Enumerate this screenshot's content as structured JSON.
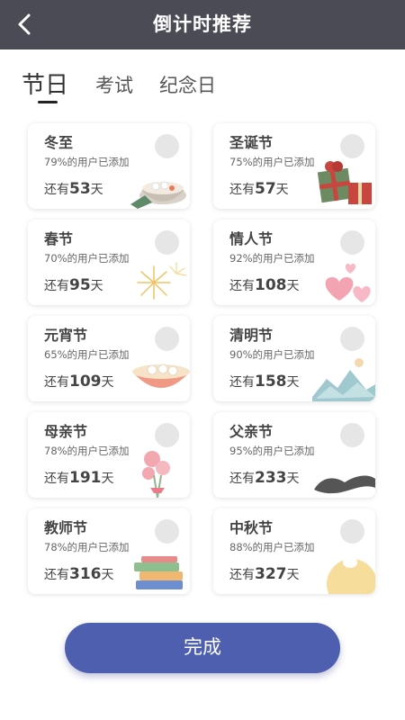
{
  "header": {
    "title": "倒计时推荐",
    "back_icon": "back-arrow-icon"
  },
  "tabs": [
    {
      "label": "节日",
      "active": true
    },
    {
      "label": "考试",
      "active": false
    },
    {
      "label": "纪念日",
      "active": false
    }
  ],
  "days_prefix": "还有",
  "days_suffix": "天",
  "cards": [
    {
      "name": "冬至",
      "pct": "79%的用户已添加",
      "days": "53",
      "illustration": "dumpling-bowl-icon"
    },
    {
      "name": "圣诞节",
      "pct": "75%的用户已添加",
      "days": "57",
      "illustration": "gift-boxes-icon"
    },
    {
      "name": "春节",
      "pct": "70%的用户已添加",
      "days": "95",
      "illustration": "fireworks-icon"
    },
    {
      "name": "情人节",
      "pct": "92%的用户已添加",
      "days": "108",
      "illustration": "hearts-icon"
    },
    {
      "name": "元宵节",
      "pct": "65%的用户已添加",
      "days": "109",
      "illustration": "yuanxiao-bowl-icon"
    },
    {
      "name": "清明节",
      "pct": "90%的用户已添加",
      "days": "158",
      "illustration": "mountains-icon"
    },
    {
      "name": "母亲节",
      "pct": "78%的用户已添加",
      "days": "191",
      "illustration": "carnation-icon"
    },
    {
      "name": "父亲节",
      "pct": "95%的用户已添加",
      "days": "233",
      "illustration": "mustache-icon"
    },
    {
      "name": "教师节",
      "pct": "78%的用户已添加",
      "days": "316",
      "illustration": "books-icon"
    },
    {
      "name": "中秋节",
      "pct": "88%的用户已添加",
      "days": "327",
      "illustration": "moon-rabbit-icon"
    }
  ],
  "done_button": {
    "label": "完成"
  },
  "colors": {
    "header_bg": "#4a4b55",
    "button_bg": "#4d5fae",
    "check_bg": "#e6e6e6"
  }
}
